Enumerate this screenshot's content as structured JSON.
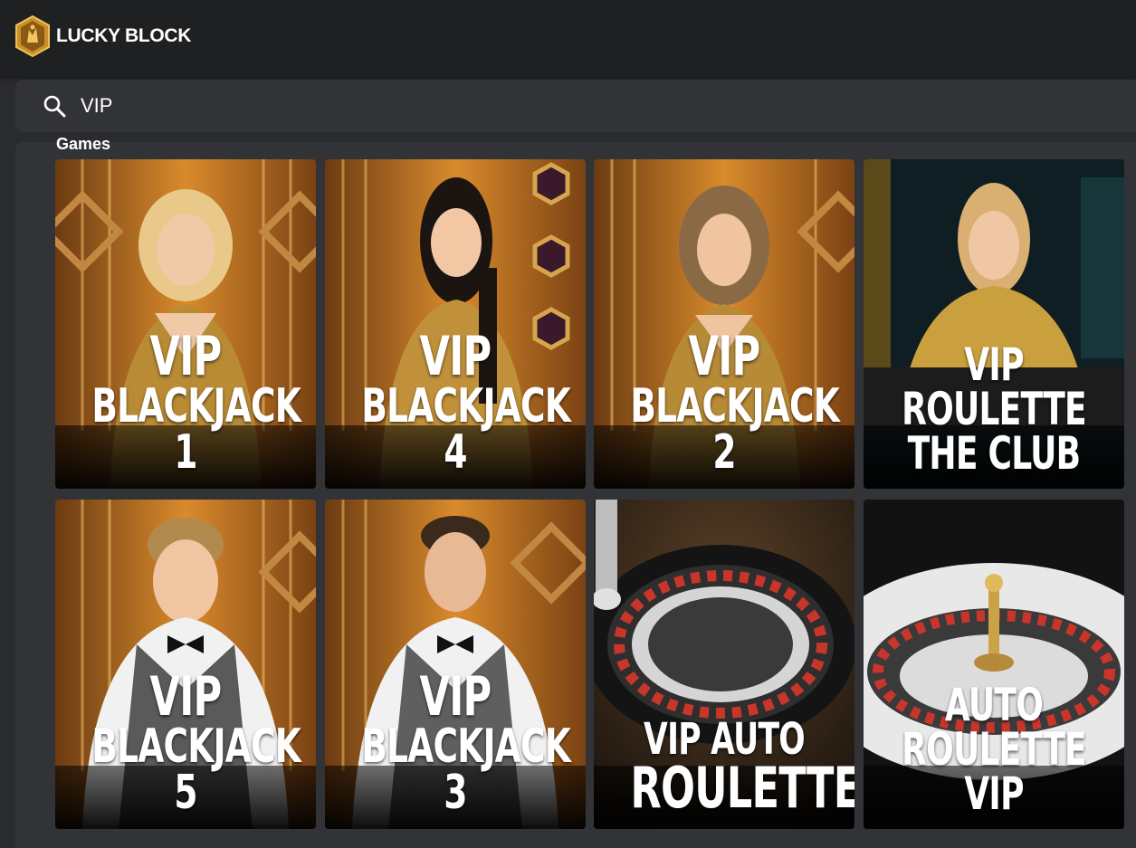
{
  "brand": {
    "name": "LUCKY BLOCK",
    "accent": "#d9a33a"
  },
  "search": {
    "value": "VIP",
    "icon": "search-icon"
  },
  "results": {
    "section_title": "Games",
    "games": [
      {
        "line1": "VIP",
        "line2": "BLACKJACK 1"
      },
      {
        "line1": "VIP",
        "line2": "BLACKJACK 4"
      },
      {
        "line1": "VIP",
        "line2": "BLACKJACK 2"
      },
      {
        "line1": "VIP ROULETTE",
        "line2": "THE CLUB"
      },
      {
        "line1": "VIP",
        "line2": "BLACKJACK 5"
      },
      {
        "line1": "VIP",
        "line2": "BLACKJACK 3"
      },
      {
        "line1": "VIP AUTO",
        "line2": "ROULETTE"
      },
      {
        "line1": "AUTO ROULETTE",
        "line2": "VIP"
      }
    ]
  }
}
